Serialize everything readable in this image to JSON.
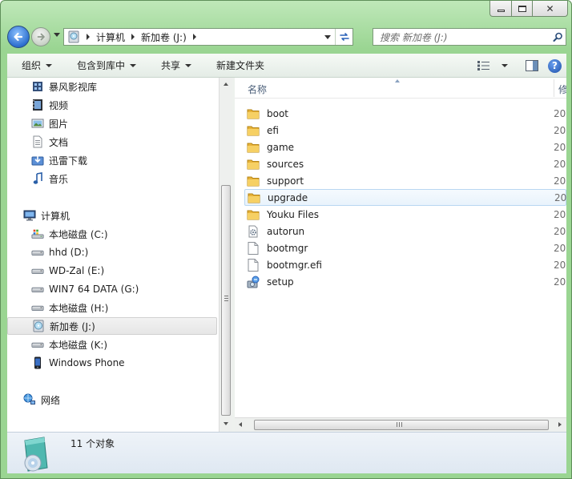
{
  "window": {
    "caption_buttons": [
      "minimize",
      "maximize",
      "close"
    ],
    "close_glyph": "✕",
    "accent_color": "#9ad592"
  },
  "address": {
    "crumbs": [
      "计算机",
      "新加卷 (J:)"
    ]
  },
  "search": {
    "placeholder": "搜索 新加卷 (J:)"
  },
  "toolbar": {
    "organize": "组织",
    "include_in_library": "包含到库中",
    "share": "共享",
    "new_folder": "新建文件夹"
  },
  "nav": {
    "items": [
      {
        "label": "暴风影视库",
        "icon": "library-icon"
      },
      {
        "label": "视频",
        "icon": "video-icon"
      },
      {
        "label": "图片",
        "icon": "picture-icon"
      },
      {
        "label": "文档",
        "icon": "document-icon"
      },
      {
        "label": "迅雷下载",
        "icon": "download-icon"
      },
      {
        "label": "音乐",
        "icon": "music-icon"
      },
      {
        "label": "计算机",
        "icon": "computer-icon"
      },
      {
        "label": "本地磁盘 (C:)",
        "icon": "system-drive-icon"
      },
      {
        "label": "hhd (D:)",
        "icon": "drive-icon"
      },
      {
        "label": "WD-Zal (E:)",
        "icon": "drive-icon"
      },
      {
        "label": "WIN7 64 DATA (G:)",
        "icon": "drive-icon"
      },
      {
        "label": "本地磁盘 (H:)",
        "icon": "drive-icon"
      },
      {
        "label": "新加卷 (J:)",
        "icon": "dvd-drive-icon"
      },
      {
        "label": "本地磁盘 (K:)",
        "icon": "drive-icon"
      },
      {
        "label": "Windows Phone",
        "icon": "phone-icon"
      },
      {
        "label": "网络",
        "icon": "network-icon"
      }
    ]
  },
  "files": {
    "col_name": "名称",
    "col_modified": "修",
    "items": [
      {
        "name": "boot",
        "type": "folder",
        "date": "20"
      },
      {
        "name": "efi",
        "type": "folder",
        "date": "20"
      },
      {
        "name": "game",
        "type": "folder",
        "date": "20"
      },
      {
        "name": "sources",
        "type": "folder",
        "date": "20"
      },
      {
        "name": "support",
        "type": "folder",
        "date": "20"
      },
      {
        "name": "upgrade",
        "type": "folder",
        "date": "20"
      },
      {
        "name": "Youku Files",
        "type": "folder",
        "date": "20"
      },
      {
        "name": "autorun",
        "type": "settings",
        "date": "20"
      },
      {
        "name": "bootmgr",
        "type": "file",
        "date": "20"
      },
      {
        "name": "bootmgr.efi",
        "type": "file",
        "date": "20"
      },
      {
        "name": "setup",
        "type": "setup",
        "date": "20"
      }
    ]
  },
  "details": {
    "count": "11 个对象"
  }
}
